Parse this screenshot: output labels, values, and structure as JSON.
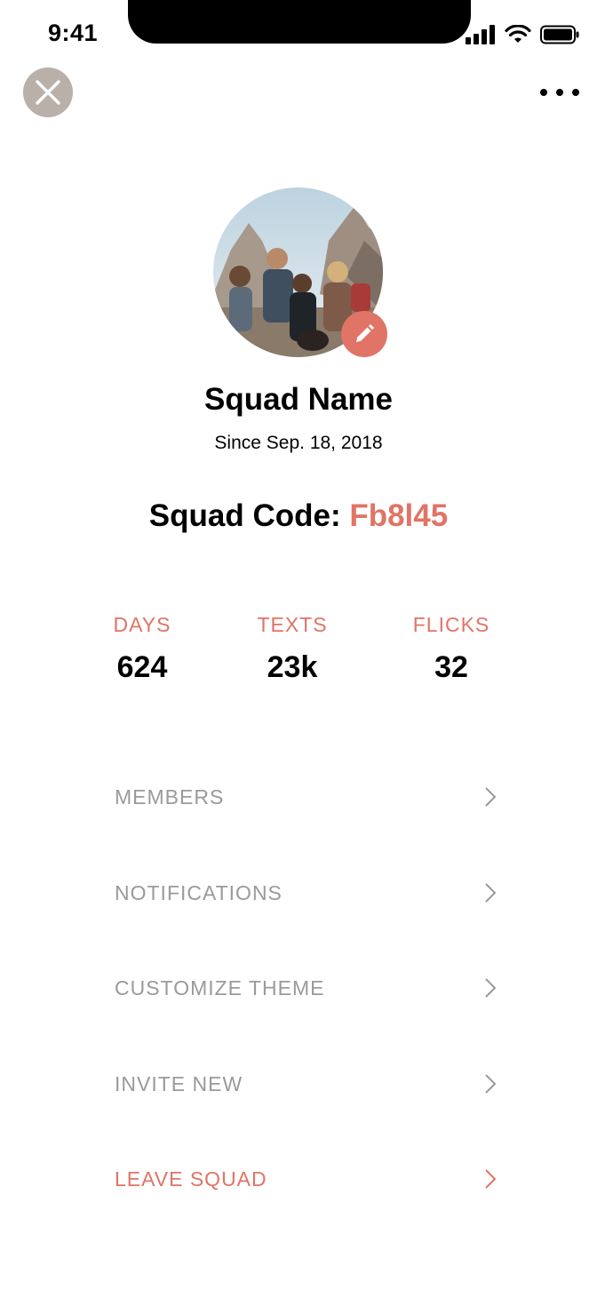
{
  "status_bar": {
    "time": "9:41"
  },
  "header": {
    "close_icon": "close-icon",
    "more_icon": "more-horizontal-icon"
  },
  "squad": {
    "name": "Squad Name",
    "since": "Since Sep. 18, 2018",
    "code_label": "Squad Code:",
    "code": "Fb8l45",
    "photo": "group-photo (friends hiking in mountains)",
    "edit_icon": "pencil-icon"
  },
  "stats": [
    {
      "label": "DAYS",
      "value": "624"
    },
    {
      "label": "TEXTS",
      "value": "23k"
    },
    {
      "label": "FLICKS",
      "value": "32"
    }
  ],
  "menu": [
    {
      "label": "MEMBERS"
    },
    {
      "label": "NOTIFICATIONS"
    },
    {
      "label": "CUSTOMIZE THEME"
    },
    {
      "label": "INVITE NEW"
    },
    {
      "label": "LEAVE SQUAD"
    }
  ],
  "colors": {
    "accent": "#e07466",
    "close_button": "#bab0aa",
    "menu_text": "#9a9a9a"
  }
}
